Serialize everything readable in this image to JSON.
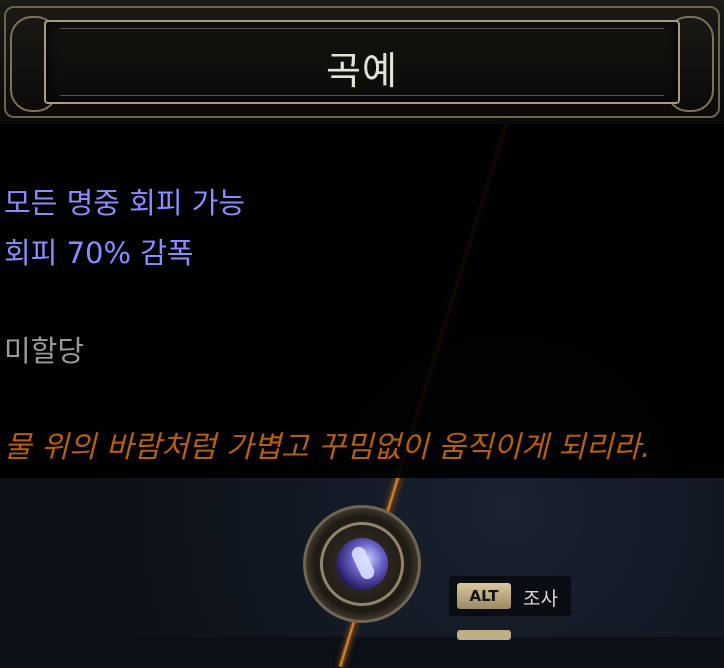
{
  "tooltip": {
    "title": "곡예",
    "stats": [
      "모든 명중 회피 가능",
      "회피 70% 감폭"
    ],
    "status": "미할당",
    "flavor": "물 위의 바람처럼 가볍고 꾸밈없이 움직이게 되리라."
  },
  "hint": {
    "key": "ALT",
    "label": "조사"
  },
  "colors": {
    "stat": "#8a8cff",
    "status": "#9a9a9a",
    "flavor": "#b85e0f",
    "title": "#e6e2d8"
  },
  "icons": {
    "skill_node": "acrobatics-keystone-icon",
    "socket": "passive-socket-frame"
  }
}
